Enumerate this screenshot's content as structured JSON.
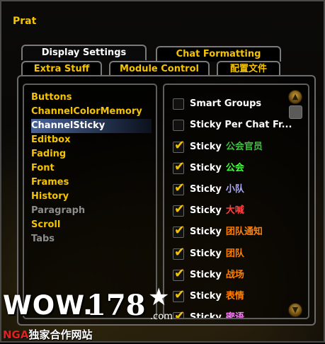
{
  "window": {
    "title": "Prat"
  },
  "tabs": {
    "row_top": [
      {
        "label": "Display Settings",
        "active": true
      },
      {
        "label": "Chat Formatting",
        "active": false
      }
    ],
    "row_bottom": [
      {
        "label": "Extra Stuff"
      },
      {
        "label": "Module Control"
      },
      {
        "label": "配置文件"
      }
    ]
  },
  "left_list": {
    "items": [
      {
        "label": "Buttons",
        "state": "normal"
      },
      {
        "label": "ChannelColorMemory",
        "state": "normal"
      },
      {
        "label": "ChannelSticky",
        "state": "selected"
      },
      {
        "label": "Editbox",
        "state": "normal"
      },
      {
        "label": "Fading",
        "state": "normal"
      },
      {
        "label": "Font",
        "state": "normal"
      },
      {
        "label": "Frames",
        "state": "normal"
      },
      {
        "label": "History",
        "state": "normal"
      },
      {
        "label": "Paragraph",
        "state": "disabled"
      },
      {
        "label": "Scroll",
        "state": "normal"
      },
      {
        "label": "Tabs",
        "state": "disabled"
      }
    ]
  },
  "options": {
    "items": [
      {
        "prefix": "Smart Groups",
        "suffix": "",
        "checked": false,
        "suffix_color": "#ffffff"
      },
      {
        "prefix": "Sticky Per Chat Fr...",
        "suffix": "",
        "checked": false,
        "suffix_color": "#ffffff"
      },
      {
        "prefix": "Sticky",
        "suffix": "公会官员",
        "checked": true,
        "suffix_color": "#40c040"
      },
      {
        "prefix": "Sticky",
        "suffix": "公会",
        "checked": true,
        "suffix_color": "#40ff40"
      },
      {
        "prefix": "Sticky",
        "suffix": "小队",
        "checked": true,
        "suffix_color": "#a8a8ff"
      },
      {
        "prefix": "Sticky",
        "suffix": "大喊",
        "checked": true,
        "suffix_color": "#ff4040"
      },
      {
        "prefix": "Sticky",
        "suffix": "团队通知",
        "checked": true,
        "suffix_color": "#ff8000"
      },
      {
        "prefix": "Sticky",
        "suffix": "团队",
        "checked": true,
        "suffix_color": "#ff8000"
      },
      {
        "prefix": "Sticky",
        "suffix": "战场",
        "checked": true,
        "suffix_color": "#ff8000"
      },
      {
        "prefix": "Sticky",
        "suffix": "表情",
        "checked": true,
        "suffix_color": "#ff8000"
      },
      {
        "prefix": "Sticky",
        "suffix": "密语",
        "checked": true,
        "suffix_color": "#ff80ff"
      }
    ]
  },
  "scrollbar": {
    "up_icon": "scroll-up-icon",
    "down_icon": "scroll-down-icon"
  },
  "watermark": {
    "wow": "WOW.",
    "num": "178",
    "com": ".com",
    "nga_prefix": "NGA",
    "nga_rest": "独家合作网站"
  }
}
